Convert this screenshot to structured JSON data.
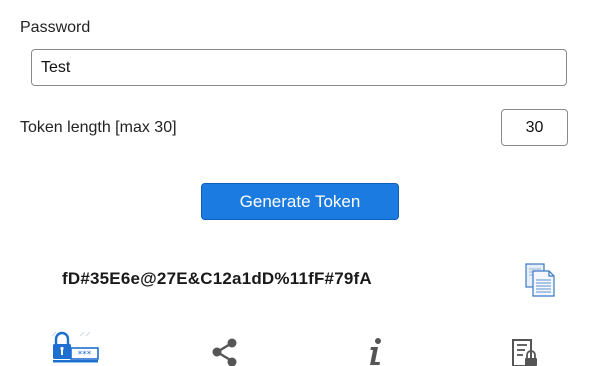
{
  "form": {
    "password_label": "Password",
    "password_value": "Test",
    "token_length_label": "Token length [max 30]",
    "token_length_value": "30",
    "generate_label": "Generate Token"
  },
  "result": {
    "token": "fD#35E6e@27E&C12a1dD%11fF#79fA",
    "copy_icon": "copy-icon"
  },
  "bottom_bar": {
    "items": [
      {
        "icon": "password-lock-icon"
      },
      {
        "icon": "share-icon"
      },
      {
        "icon": "info-icon"
      },
      {
        "icon": "secure-document-icon"
      }
    ]
  },
  "colors": {
    "accent": "#1c7be0",
    "icon_blue": "#1f6fd1",
    "icon_gray": "#555555"
  }
}
